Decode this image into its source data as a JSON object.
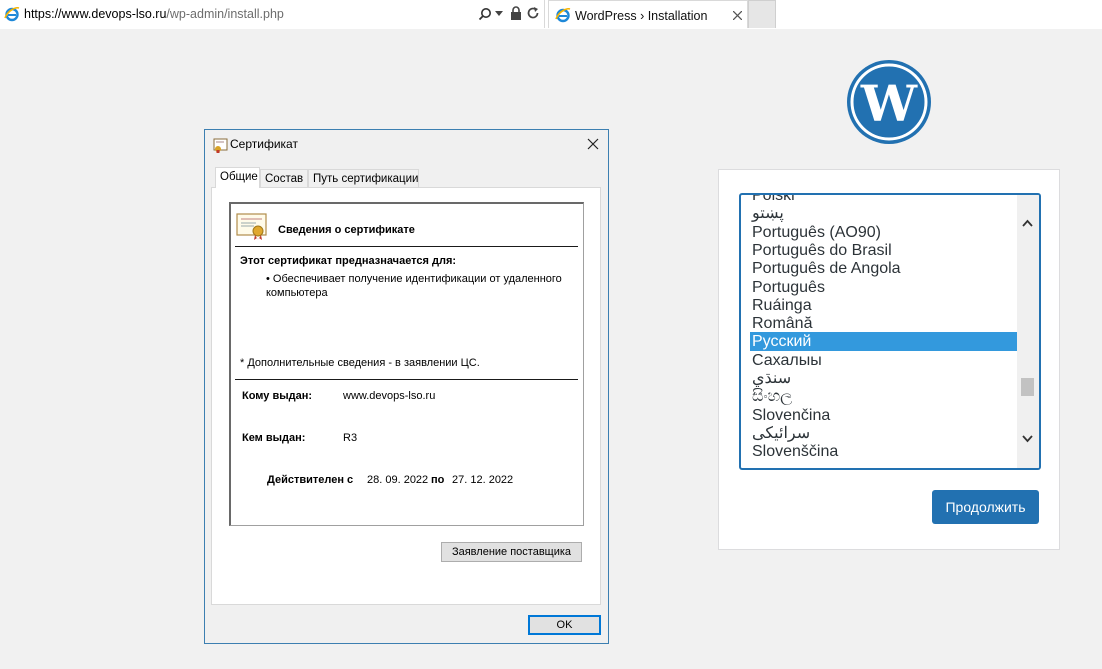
{
  "browser": {
    "address_scheme_host": "https://www.devops-lso.ru",
    "address_path": "/wp-admin/install.php",
    "tab_title": "WordPress › Installation"
  },
  "wordpress": {
    "language_options": [
      "Polski",
      "پښتو",
      "Português (AO90)",
      "Português do Brasil",
      "Português de Angola",
      "Português",
      "Ruáinga",
      "Română",
      "Русский",
      "Сахалыы",
      "سنڌي",
      "සිංහල",
      "Slovenčina",
      "سرائیکی",
      "Slovenščina"
    ],
    "selected_language": "Русский",
    "continue_label": "Продолжить",
    "brand_color": "#2271b1"
  },
  "certificate": {
    "title": "Сертификат",
    "tabs": [
      "Общие",
      "Состав",
      "Путь сертификации"
    ],
    "heading": "Сведения о сертификате",
    "purpose_heading": "Этот сертификат предназначается для:",
    "purpose_item_line1": "• Обеспечивает получение идентификации от удаленного",
    "purpose_item_line2": "компьютера",
    "footnote": "* Дополнительные сведения - в заявлении ЦС.",
    "issued_to_label": "Кому выдан:",
    "issued_to_value": "www.devops-lso.ru",
    "issued_by_label": "Кем выдан:",
    "issued_by_value": "R3",
    "valid_from_label": "Действителен с",
    "valid_from": "28. 09. 2022",
    "valid_to_label": "по",
    "valid_to": "27. 12. 2022",
    "issuer_statement_button": "Заявление поставщика",
    "ok_button": "OK"
  }
}
